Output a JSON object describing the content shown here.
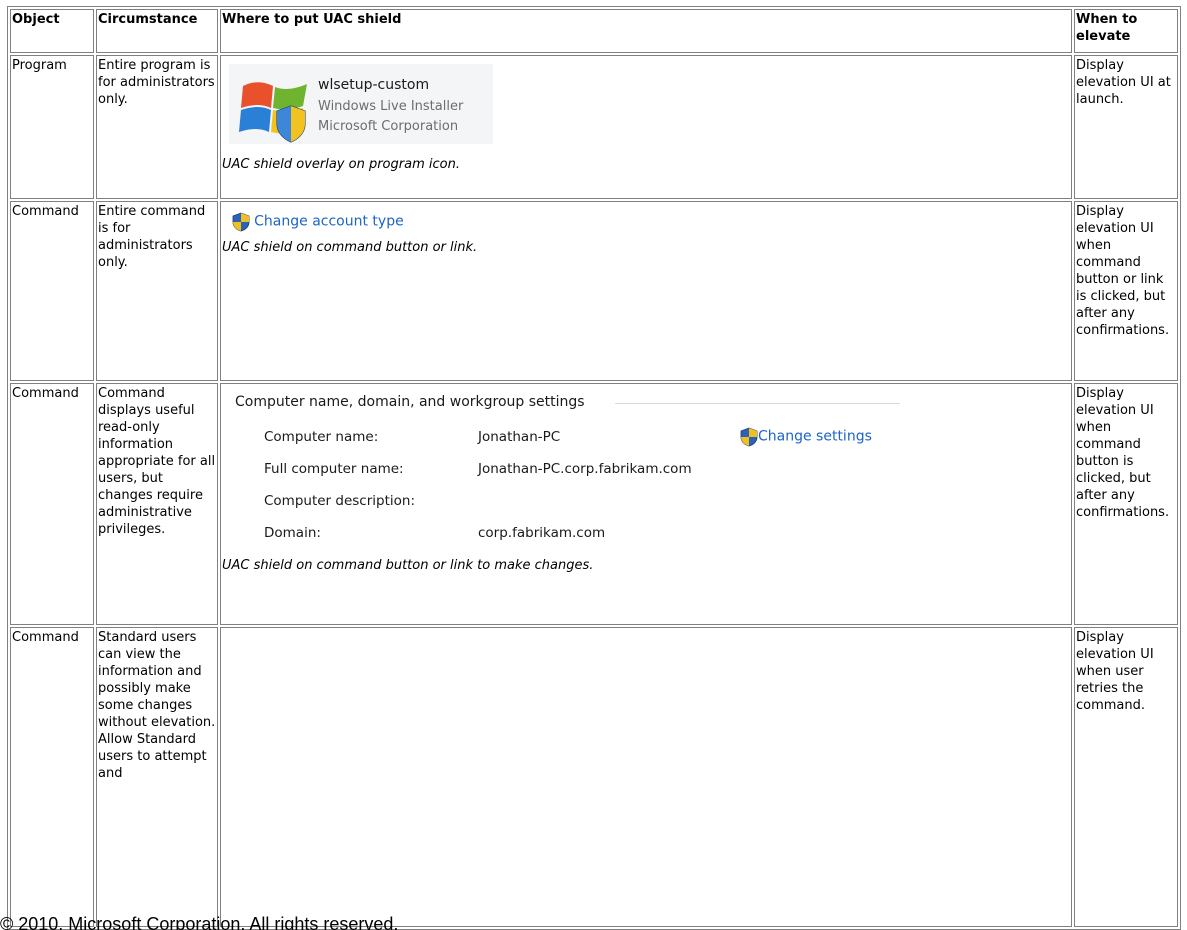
{
  "headers": {
    "object": "Object",
    "circumstance": "Circumstance",
    "where": "Where to put UAC shield",
    "when": "When to elevate"
  },
  "rows": [
    {
      "object": "Program",
      "circumstance": "Entire program is for administrators only.",
      "program_tile": {
        "name": "wlsetup-custom",
        "description": "Windows Live Installer",
        "company": "Microsoft Corporation"
      },
      "caption": "UAC shield overlay on program icon.",
      "when": "Display elevation UI at launch."
    },
    {
      "object": "Command",
      "circumstance": "Entire command is for administrators only.",
      "link": "Change account type",
      "caption": "UAC shield on command button or link.",
      "when": "Display elevation UI when command button or link is clicked, but after any confirmations."
    },
    {
      "object": "Command",
      "circumstance": "Command displays useful read-only information appropriate for all users, but changes require administrative privileges.",
      "group_title": "Computer name, domain, and workgroup settings",
      "fields": [
        {
          "label": "Computer name:",
          "value": "Jonathan-PC"
        },
        {
          "label": "Full computer name:",
          "value": "Jonathan-PC.corp.fabrikam.com"
        },
        {
          "label": "Computer description:",
          "value": ""
        },
        {
          "label": "Domain:",
          "value": "corp.fabrikam.com"
        }
      ],
      "change_link": "Change settings",
      "caption": "UAC shield on command button or link to make changes.",
      "when": "Display elevation UI when command button is clicked, but after any confirmations."
    },
    {
      "object": "Command",
      "circumstance": "Standard users can view the information and possibly make some changes without elevation. Allow Standard users to attempt and",
      "when": "Display elevation UI when user retries the command."
    }
  ],
  "footer": "© 2010, Microsoft Corporation. All rights reserved.",
  "colors": {
    "link": "#1e64c8",
    "border": "#808080",
    "muted_text": "#6d6d6d"
  },
  "icons": [
    "uac-shield-icon",
    "windows-flag-icon"
  ]
}
